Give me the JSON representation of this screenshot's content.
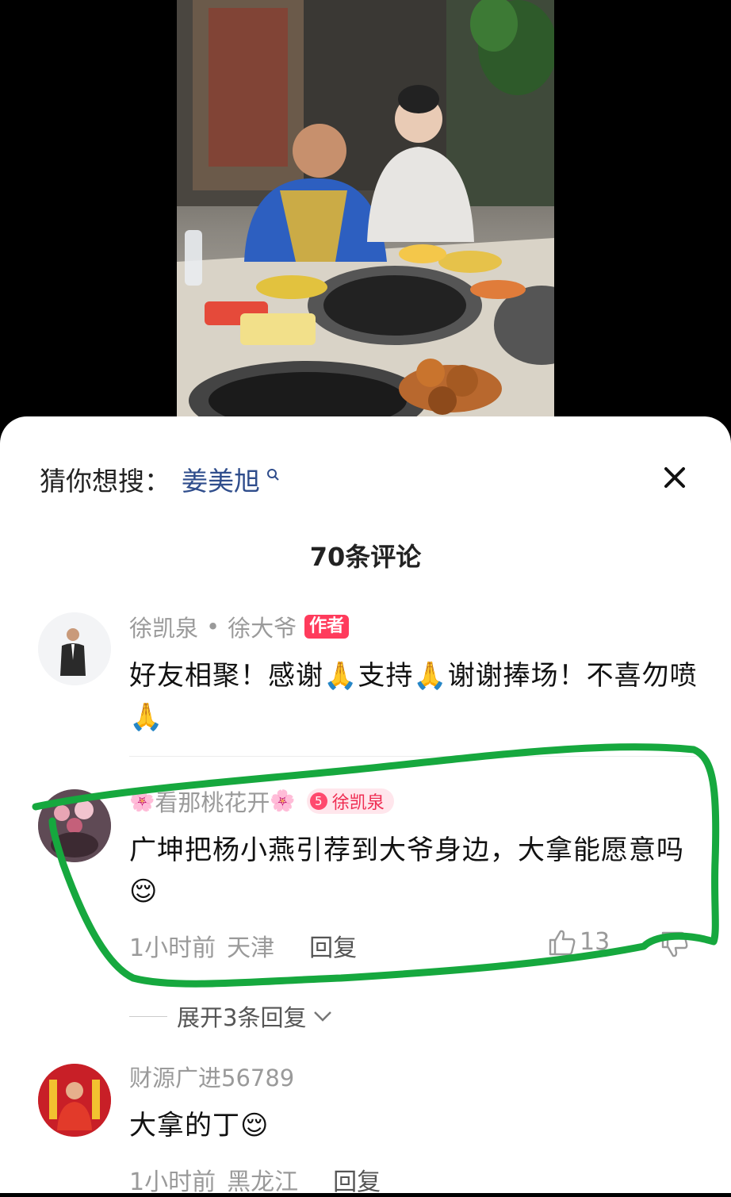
{
  "search_hint": {
    "label": "猜你想搜：",
    "keyword": "姜美旭"
  },
  "comment_count_title": "70条评论",
  "comments": [
    {
      "user": "徐凯泉",
      "dot": "•",
      "alias": "徐大爷",
      "badge": "作者",
      "text_parts": [
        "好友相聚！感谢",
        "🙏",
        "支持",
        "🙏",
        "谢谢捧场！不喜勿喷",
        "🙏"
      ]
    },
    {
      "user_prefix": "🌸",
      "user": "看那桃花开",
      "user_suffix": "🌸",
      "fan_level": "5",
      "fan_name": "徐凯泉",
      "text": "广坤把杨小燕引荐到大爷身边，大拿能愿意吗",
      "emoji": "😌",
      "time": "1小时前",
      "location": "天津",
      "reply_label": "回复",
      "likes": "13",
      "expand_label": "展开3条回复"
    },
    {
      "user": "财源广进56789",
      "text": "大拿的丁",
      "emoji": "😌",
      "time": "1小时前",
      "location": "黑龙江",
      "reply_label": "回复"
    }
  ],
  "icons": {
    "close": "close-icon",
    "search": "search-icon",
    "like": "thumbs-up-icon",
    "dislike": "thumbs-down-icon",
    "expand": "chevron-down-icon"
  },
  "colors": {
    "keyword": "#2f4d8c",
    "author_badge": "#ff3b5c",
    "fan_badge_bg": "#ffe6ec",
    "highlight_stroke": "#16a83e"
  }
}
